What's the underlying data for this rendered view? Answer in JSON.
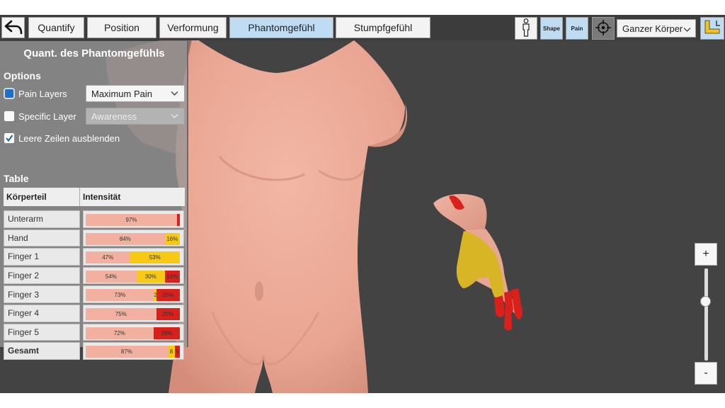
{
  "toolbar": {
    "tabs": [
      {
        "label": "Quantify",
        "active": false
      },
      {
        "label": "Position",
        "active": false
      },
      {
        "label": "Verformung",
        "active": false
      },
      {
        "label": "Phantomgefühl",
        "active": true
      },
      {
        "label": "Stumpfgefühl",
        "active": false
      }
    ],
    "shape_label": "Shape",
    "pain_label": "Pain",
    "body_region": "Ganzer Körper",
    "icons": {
      "back": "back-arrow-icon",
      "person": "person-icon",
      "target": "crosshair-icon",
      "arm": "arm-icon"
    }
  },
  "panel": {
    "title": "Quant. des Phantomgefühls",
    "options_heading": "Options",
    "pain_layers_label": "Pain Layers",
    "pain_layers_value": "Maximum Pain",
    "specific_layer_label": "Specific Layer",
    "specific_layer_value": "Awareness",
    "hide_empty_label": "Leere Zeilen ausblenden",
    "table_heading": "Table",
    "columns": [
      "Körperteil",
      "Intensität"
    ],
    "rows": [
      {
        "name": "Unterarm",
        "bold": false,
        "segments": [
          {
            "pct": 97,
            "label": "97%",
            "color": "#f2b1a0"
          },
          {
            "pct": 3,
            "label": "",
            "color": "#d9201b"
          }
        ]
      },
      {
        "name": "Hand",
        "bold": false,
        "segments": [
          {
            "pct": 84,
            "label": "84%",
            "color": "#f2b1a0"
          },
          {
            "pct": 16,
            "label": "16%",
            "color": "#f7c915"
          }
        ]
      },
      {
        "name": "Finger 1",
        "bold": false,
        "segments": [
          {
            "pct": 47,
            "label": "47%",
            "color": "#f2b1a0"
          },
          {
            "pct": 53,
            "label": "53%",
            "color": "#f7c915"
          }
        ]
      },
      {
        "name": "Finger 2",
        "bold": false,
        "segments": [
          {
            "pct": 54,
            "label": "54%",
            "color": "#f2b1a0"
          },
          {
            "pct": 30,
            "label": "30%",
            "color": "#f7c915"
          },
          {
            "pct": 16,
            "label": "16%",
            "color": "#d9201b"
          }
        ]
      },
      {
        "name": "Finger 3",
        "bold": false,
        "segments": [
          {
            "pct": 73,
            "label": "73%",
            "color": "#f2b1a0"
          },
          {
            "pct": 2,
            "label": "2",
            "color": "#f7c915"
          },
          {
            "pct": 25,
            "label": "25%",
            "color": "#d9201b"
          }
        ]
      },
      {
        "name": "Finger 4",
        "bold": false,
        "segments": [
          {
            "pct": 75,
            "label": "75%",
            "color": "#f2b1a0"
          },
          {
            "pct": 25,
            "label": "25%",
            "color": "#d9201b"
          }
        ]
      },
      {
        "name": "Finger 5",
        "bold": false,
        "segments": [
          {
            "pct": 72,
            "label": "72%",
            "color": "#f2b1a0"
          },
          {
            "pct": 28,
            "label": "28%",
            "color": "#d9201b"
          }
        ]
      },
      {
        "name": "Gesamt",
        "bold": true,
        "segments": [
          {
            "pct": 87,
            "label": "87%",
            "color": "#f2b1a0"
          },
          {
            "pct": 8,
            "label": "8",
            "color": "#f7c915"
          },
          {
            "pct": 5,
            "label": "5",
            "color": "#d9201b"
          }
        ]
      }
    ]
  },
  "zoom": {
    "plus_label": "+",
    "minus_label": "-",
    "level": 0.5
  },
  "colors": {
    "skin": "#efae9c",
    "pain_yellow": "#d8b524",
    "pain_red": "#d9201b",
    "active_tab": "#bfdcf3",
    "background": "#434343"
  }
}
